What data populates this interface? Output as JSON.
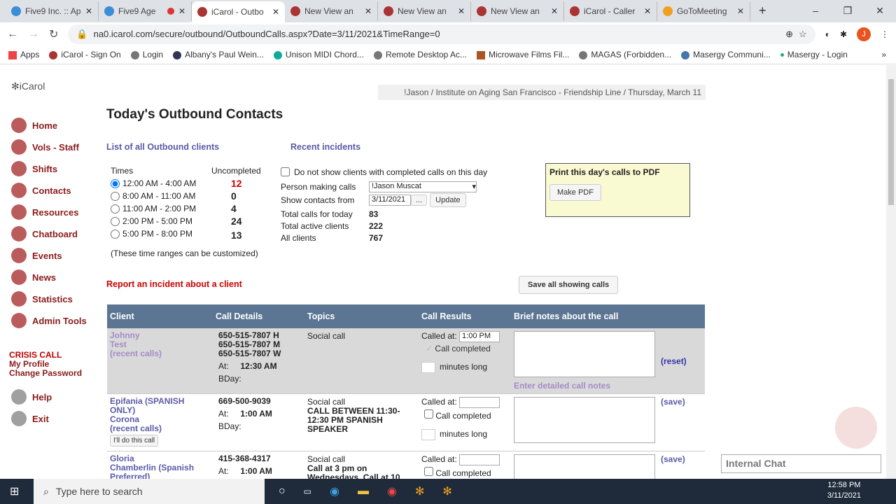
{
  "browser": {
    "tabs": [
      {
        "label": "Five9 Inc. :: Ap",
        "color": "#3b8ed6"
      },
      {
        "label": "Five9 Age",
        "color": "#3b8ed6"
      },
      {
        "label": "iCarol - Outbo",
        "color": "#a33"
      },
      {
        "label": "New View an",
        "color": "#a33"
      },
      {
        "label": "New View an",
        "color": "#a33"
      },
      {
        "label": "New View an",
        "color": "#a33"
      },
      {
        "label": "iCarol - Caller",
        "color": "#a33"
      },
      {
        "label": "GoToMeeting",
        "color": "#f0a020"
      }
    ],
    "url": "na0.icarol.com/secure/outbound/OutboundCalls.aspx?Date=3/11/2021&TimeRange=0",
    "avatar": "J",
    "bookmarks": [
      "Apps",
      "iCarol - Sign On",
      "Login",
      "Albany's Paul Wein...",
      "Unison MIDI Chord...",
      "Remote Desktop Ac...",
      "Microwave Films Fil...",
      "MAGAS (Forbidden...",
      "Masergy Communi...",
      "Masergy - Login"
    ]
  },
  "sidebar": {
    "logo": "iCarol",
    "items": [
      "Home",
      "Vols - Staff",
      "Shifts",
      "Contacts",
      "Resources",
      "Chatboard",
      "Events",
      "News",
      "Statistics",
      "Admin Tools"
    ],
    "crisis": "CRISIS CALL",
    "profile": "My Profile",
    "password": "Change Password",
    "help": "Help",
    "exit": "Exit"
  },
  "header": {
    "context": "!Jason / Institute on Aging San Francisco - Friendship Line / Thursday, March 11",
    "title": "Today's Outbound Contacts"
  },
  "links": {
    "all_clients": "List of all Outbound clients",
    "recent_incidents": "Recent incidents",
    "report": "Report an incident about a client"
  },
  "times": {
    "label": "Times",
    "uncompleted_label": "Uncompleted",
    "ranges": [
      {
        "label": "12:00 AM - 4:00 AM",
        "count": "12"
      },
      {
        "label": "8:00 AM - 11:00 AM",
        "count": "0"
      },
      {
        "label": "11:00 AM - 2:00 PM",
        "count": "4"
      },
      {
        "label": "2:00 PM - 5:00 PM",
        "count": "24"
      },
      {
        "label": "5:00 PM - 8:00 PM",
        "count": "13"
      }
    ],
    "note": "(These time ranges can be customized)"
  },
  "form": {
    "hide_completed": "Do not show clients with completed calls on this day",
    "person_label": "Person making calls",
    "person_value": "!Jason Muscat",
    "from_label": "Show contacts from",
    "from_value": "3/11/2021",
    "dots": "...",
    "update": "Update",
    "total_today_label": "Total calls for today",
    "total_today": "83",
    "active_label": "Total active clients",
    "active": "222",
    "all_label": "All clients",
    "all": "767"
  },
  "pdf": {
    "title": "Print this day's calls to PDF",
    "button": "Make PDF"
  },
  "save_all": "Save all showing calls",
  "table": {
    "headers": [
      "Client",
      "Call Details",
      "Topics",
      "Call Results",
      "Brief notes about the call"
    ],
    "called_at": "Called at:",
    "completed": "Call completed",
    "minutes": "minutes long",
    "rows": [
      {
        "client": [
          "Johnny",
          "Test",
          "(recent calls)"
        ],
        "phones": [
          "650-515-7807 H",
          "650-515-7807 M",
          "650-515-7807 W"
        ],
        "at_label": "At:",
        "at": "12:30 AM",
        "bday": "BDay:",
        "topic": "Social call",
        "topic_note": "",
        "called": "1:00 PM",
        "action": "(reset)",
        "detail_link": "Enter detailed call notes"
      },
      {
        "client": [
          "Epifania (SPANISH ONLY)",
          "Corona",
          "(recent calls)"
        ],
        "phones": [
          "669-500-9039"
        ],
        "at_label": "At:",
        "at": "1:00 AM",
        "bday": "BDay:",
        "topic": "Social call",
        "topic_note": "CALL BETWEEN 11:30-12:30 PM SPANISH SPEAKER",
        "called": "",
        "action": "(save)",
        "do_call": "I'll do this call"
      },
      {
        "client": [
          "Gloria",
          "Chamberlin (Spanish",
          "Preferred)"
        ],
        "phones": [
          "415-368-4317"
        ],
        "at_label": "At:",
        "at": "1:00 AM",
        "topic": "Social call",
        "topic_note": "Call at 3 pm on Wednesdays. Call at 10",
        "called": "",
        "action": "(save)"
      }
    ]
  },
  "chat": "Internal Chat",
  "taskbar": {
    "search": "Type here to search",
    "time": "12:58 PM",
    "date": "3/11/2021"
  }
}
